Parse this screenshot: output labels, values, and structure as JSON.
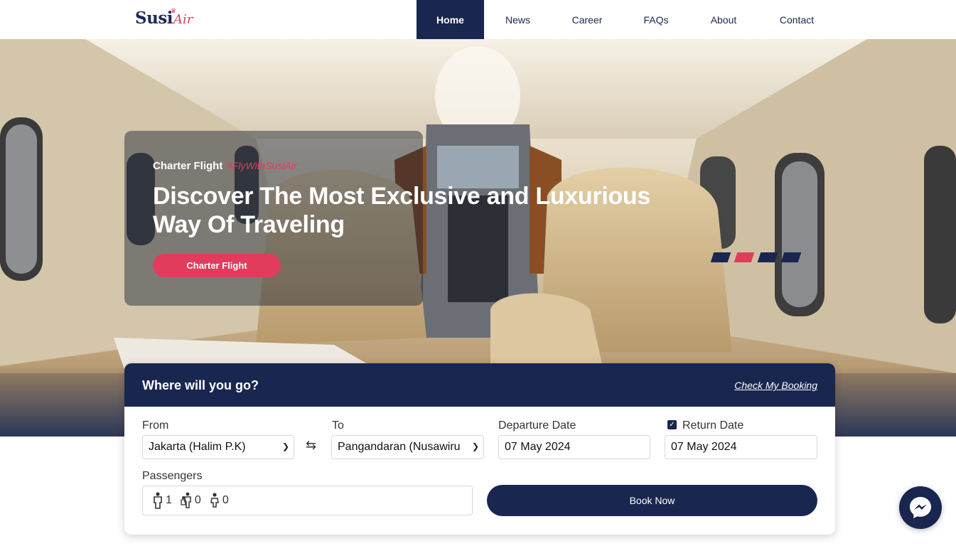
{
  "brand": {
    "name": "Susi",
    "suffix": "Air"
  },
  "nav": {
    "items": [
      {
        "label": "Home",
        "active": true
      },
      {
        "label": "News",
        "active": false
      },
      {
        "label": "Career",
        "active": false
      },
      {
        "label": "FAQs",
        "active": false
      },
      {
        "label": "About",
        "active": false
      },
      {
        "label": "Contact",
        "active": false
      }
    ]
  },
  "hero": {
    "subtitle": "Charter Flight",
    "hashtag": "#FlyWithSusiAir",
    "title": "Discover The Most Exclusive and Luxurious Way Of Traveling",
    "button_label": "Charter Flight",
    "slides_total": 4,
    "active_slide": 2
  },
  "booking": {
    "title": "Where will you go?",
    "check_booking_label": "Check My Booking",
    "from": {
      "label": "From",
      "value": "Jakarta (Halim P.K)"
    },
    "to": {
      "label": "To",
      "value": "Pangandaran (Nusawiru"
    },
    "departure": {
      "label": "Departure Date",
      "value": "07 May 2024"
    },
    "return": {
      "label": "Return Date",
      "value": "07 May 2024",
      "checked": true
    },
    "passengers": {
      "label": "Passengers",
      "adult": "1",
      "child": "0",
      "infant": "0"
    },
    "book_button_label": "Book Now"
  },
  "colors": {
    "navy": "#19264f",
    "accent": "#e23c5c"
  },
  "icons": {
    "messenger": "messenger-icon",
    "swap": "swap-arrows-icon"
  }
}
